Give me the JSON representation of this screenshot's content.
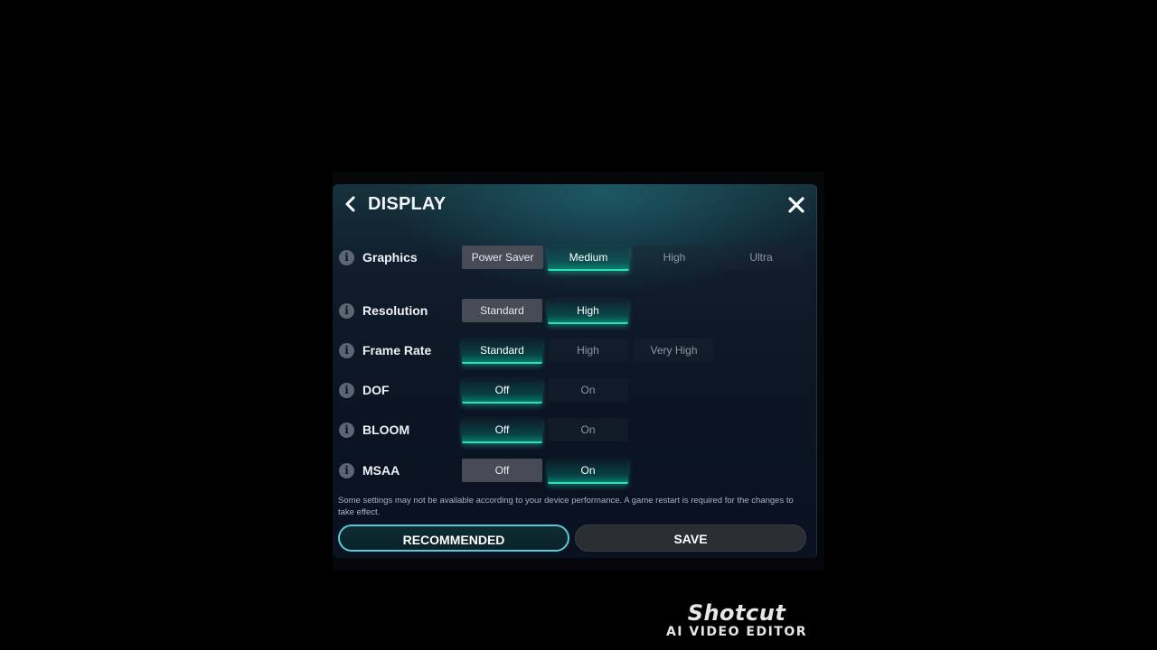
{
  "header": {
    "title": "DISPLAY",
    "back_icon": "chevron-left-icon",
    "close_icon": "close-icon"
  },
  "settings": {
    "graphics": {
      "label": "Graphics",
      "options": [
        "Power Saver",
        "Medium",
        "High",
        "Ultra"
      ],
      "selected": "Medium"
    },
    "resolution": {
      "label": "Resolution",
      "options": [
        "Standard",
        "High"
      ],
      "selected": "High"
    },
    "frame_rate": {
      "label": "Frame Rate",
      "options": [
        "Standard",
        "High",
        "Very High"
      ],
      "selected": "Standard"
    },
    "dof": {
      "label": "DOF",
      "options": [
        "Off",
        "On"
      ],
      "selected": "Off"
    },
    "bloom": {
      "label": "BLOOM",
      "options": [
        "Off",
        "On"
      ],
      "selected": "Off"
    },
    "msaa": {
      "label": "MSAA",
      "options": [
        "Off",
        "On"
      ],
      "selected": "On"
    }
  },
  "note": "Some settings may not be available according to your device performance. A game restart is required for the changes to take effect.",
  "buttons": {
    "recommended": "RECOMMENDED",
    "save": "SAVE"
  },
  "watermark": {
    "logo": "Shotcut",
    "subtitle": "AI VIDEO EDITOR"
  },
  "colors": {
    "accent": "#2fe0b8",
    "recommended_border": "#5ac8d8",
    "panel_bg": "#0c1524"
  }
}
